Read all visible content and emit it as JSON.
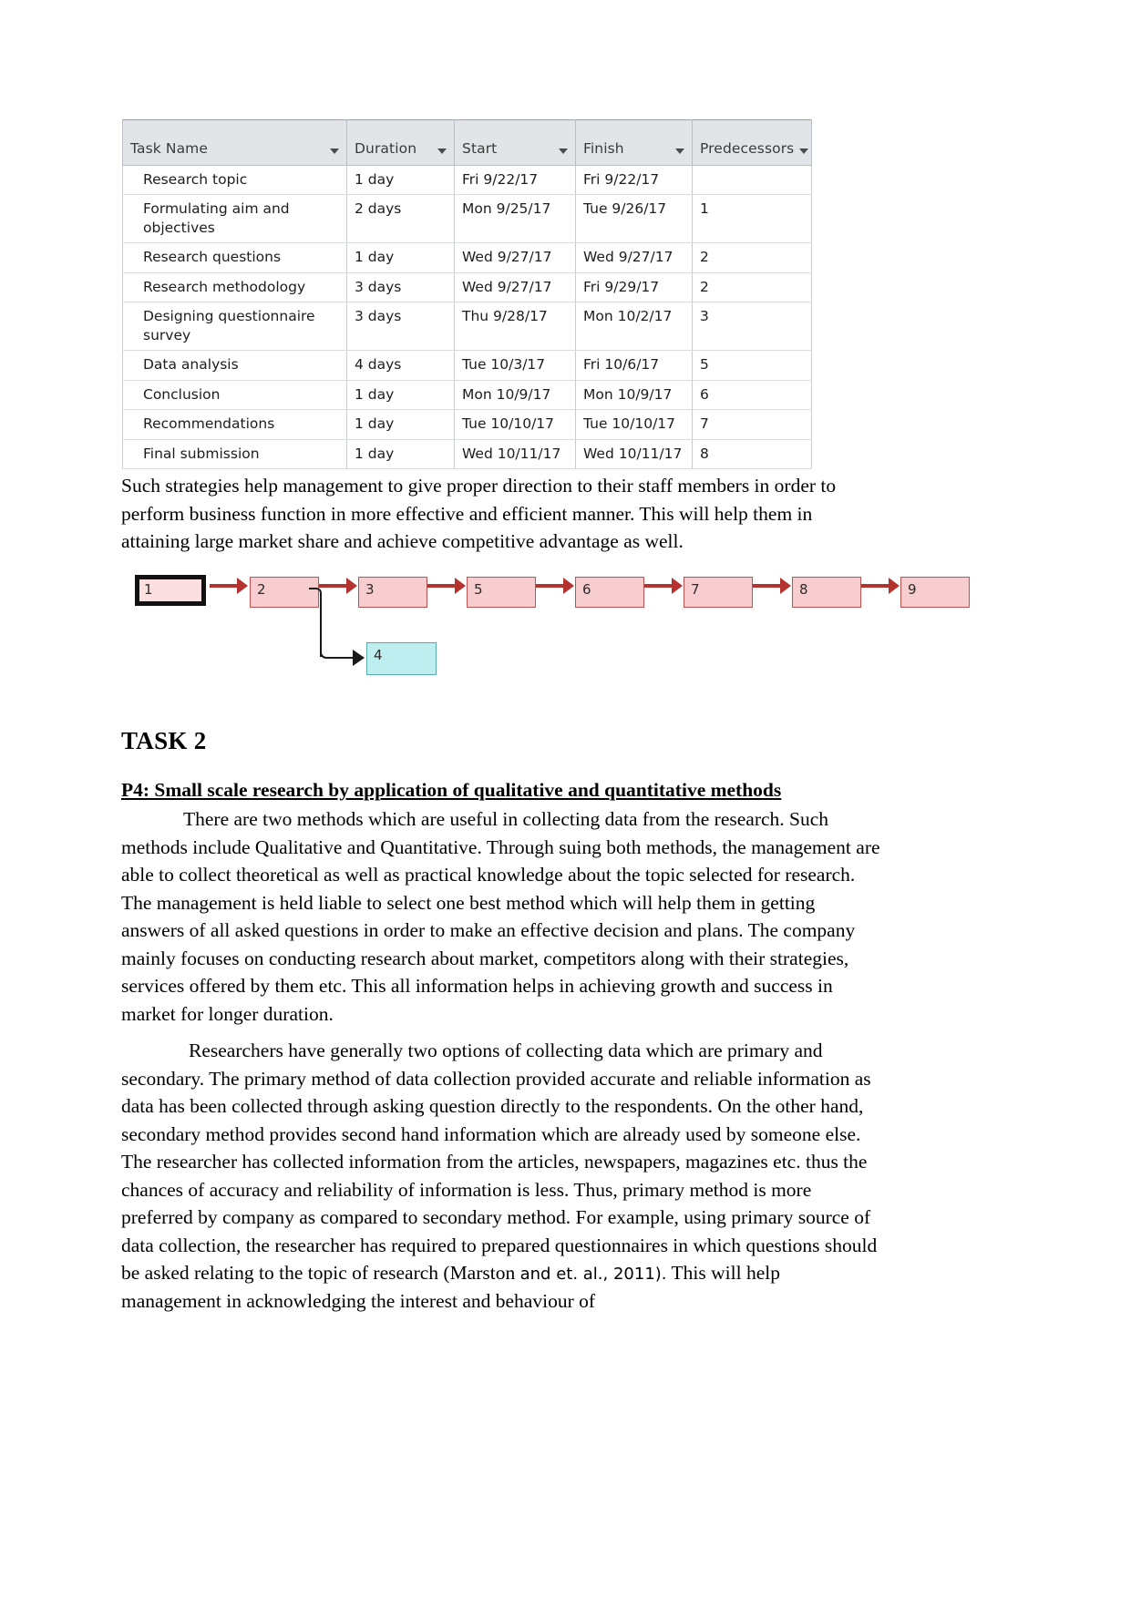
{
  "task_table": {
    "columns": [
      {
        "label": "Task Name",
        "caret": "sort-caret-icon"
      },
      {
        "label": "Duration",
        "caret": "sort-caret-icon"
      },
      {
        "label": "Start",
        "caret": "sort-caret-icon"
      },
      {
        "label": "Finish",
        "caret": "sort-caret-icon"
      },
      {
        "label": "Predecessors",
        "caret": "sort-caret-icon"
      }
    ],
    "rows": [
      {
        "name": "Research topic",
        "duration": "1 day",
        "start": "Fri 9/22/17",
        "finish": "Fri 9/22/17",
        "pred": ""
      },
      {
        "name": "Formulating aim and objectives",
        "duration": "2 days",
        "start": "Mon 9/25/17",
        "finish": "Tue 9/26/17",
        "pred": "1"
      },
      {
        "name": "Research questions",
        "duration": "1 day",
        "start": "Wed 9/27/17",
        "finish": "Wed 9/27/17",
        "pred": "2"
      },
      {
        "name": "Research methodology",
        "duration": "3 days",
        "start": "Wed 9/27/17",
        "finish": "Fri 9/29/17",
        "pred": "2"
      },
      {
        "name": "Designing questionnaire survey",
        "duration": "3 days",
        "start": "Thu 9/28/17",
        "finish": "Mon 10/2/17",
        "pred": "3"
      },
      {
        "name": "Data analysis",
        "duration": "4 days",
        "start": "Tue 10/3/17",
        "finish": "Fri 10/6/17",
        "pred": "5"
      },
      {
        "name": "Conclusion",
        "duration": "1 day",
        "start": "Mon 10/9/17",
        "finish": "Mon 10/9/17",
        "pred": "6"
      },
      {
        "name": "Recommendations",
        "duration": "1 day",
        "start": "Tue 10/10/17",
        "finish": "Tue 10/10/17",
        "pred": "7"
      },
      {
        "name": "Final submission",
        "duration": "1 day",
        "start": "Wed 10/11/17",
        "finish": "Wed 10/11/17",
        "pred": "8",
        "highlight": true
      }
    ]
  },
  "paragraphs": {
    "p1": "Such strategies help management to give proper direction to their staff members in order to perform business function in more effective and efficient manner. This will help them in attaining large market share and achieve competitive advantage as well.",
    "p2": "There are two methods which are useful in collecting data from the research. Such methods include Qualitative and Quantitative. Through suing both methods, the management are able to collect theoretical as well as practical knowledge about the topic selected for research. The management is held liable to select one best method which will help them in getting answers of all asked questions in order to make an effective decision and plans. The company mainly focuses on conducting research about market, competitors along with their strategies, services offered by them etc. This all information helps in achieving growth and success in market for longer duration.",
    "p3_main": "Researchers have generally two options of collecting data which are primary and secondary. The primary method of data collection provided accurate and reliable information as data has been collected through asking question directly to the respondents. On the other hand, secondary method provides second hand information which are already used by someone else. The researcher has collected information from the articles, newspapers, magazines etc. thus the chances of accuracy and reliability of information is less. Thus, primary method is more preferred by company as compared to secondary method. For example, using primary source of data collection, the researcher has required to prepared questionnaires in which questions should be asked relating to the topic of research (Marston ",
    "p3_citation": "and et. al., 2011).",
    "p3_tail": " This will help management in acknowledging the interest and behaviour of"
  },
  "headings": {
    "task2": "TASK 2",
    "p4": "P4: Small scale research by application of qualitative and quantitative methods"
  },
  "network_diagram": {
    "nodes": [
      {
        "label": "1",
        "type": "start"
      },
      {
        "label": "2",
        "type": "normal"
      },
      {
        "label": "3",
        "type": "normal"
      },
      {
        "label": "4",
        "type": "branch"
      },
      {
        "label": "5",
        "type": "normal"
      },
      {
        "label": "6",
        "type": "normal"
      },
      {
        "label": "7",
        "type": "normal"
      },
      {
        "label": "8",
        "type": "normal"
      },
      {
        "label": "9",
        "type": "normal"
      }
    ],
    "colors": {
      "node_fill": "#f8cdd0",
      "node_border": "#c0504d",
      "branch_fill": "#bfeef0",
      "branch_border": "#5aa9ad",
      "arrow": "#b5332f",
      "branch_arrow": "#1a1a1a",
      "start_border": "#111111"
    }
  },
  "colors": {
    "table_header_bg": "#e2e5e8",
    "highlight_cell": "#dbe5f1",
    "page_bg": "#ffffff",
    "text": "#000000"
  }
}
